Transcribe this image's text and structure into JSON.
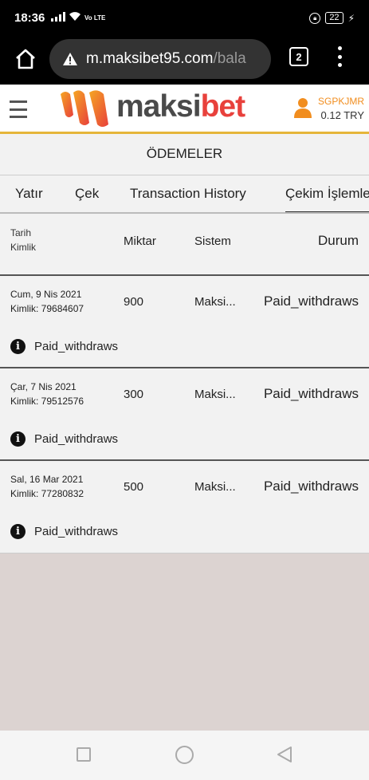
{
  "status_bar": {
    "time": "18:36",
    "volte": "Vo LTE",
    "battery": "22"
  },
  "browser": {
    "url_host": "m.maksibet95.com",
    "url_path": "/bala",
    "tab_count": "2"
  },
  "header": {
    "logo_part1": "maksi",
    "logo_part2": "bet",
    "username": "SGPKJMR",
    "balance": "0.12 TRY",
    "colors": {
      "accent": "#e6b63a",
      "brand_red": "#e8413c",
      "user_orange": "#f18d1e"
    }
  },
  "page": {
    "title": "ÖDEMELER"
  },
  "tabs": [
    {
      "label": "Yatır"
    },
    {
      "label": "Çek"
    },
    {
      "label": "Transaction History"
    },
    {
      "label": "Çekim İşlemleri",
      "active": true
    }
  ],
  "table": {
    "headers": {
      "date": "Tarih",
      "id": "Kimlik",
      "amount": "Miktar",
      "system": "Sistem",
      "status": "Durum"
    },
    "rows": [
      {
        "date": "Cum, 9 Nis 2021",
        "id": "Kimlik: 79684607",
        "amount": "900",
        "system": "Maksi...",
        "status": "Paid_withdraws",
        "detail": "Paid_withdraws"
      },
      {
        "date": "Çar, 7 Nis 2021",
        "id": "Kimlik: 79512576",
        "amount": "300",
        "system": "Maksi...",
        "status": "Paid_withdraws",
        "detail": "Paid_withdraws"
      },
      {
        "date": "Sal, 16 Mar 2021",
        "id": "Kimlik: 77280832",
        "amount": "500",
        "system": "Maksi...",
        "status": "Paid_withdraws",
        "detail": "Paid_withdraws"
      }
    ]
  }
}
